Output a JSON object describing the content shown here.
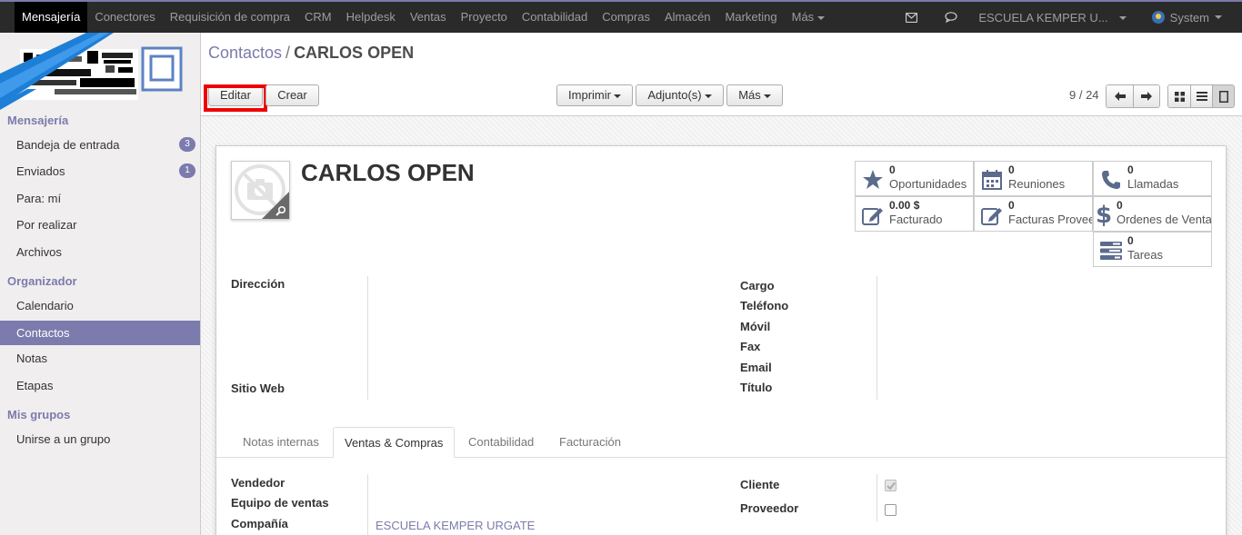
{
  "topbar": {
    "menus": [
      "Mensajería",
      "Conectores",
      "Requisición de compra",
      "CRM",
      "Helpdesk",
      "Ventas",
      "Proyecto",
      "Contabilidad",
      "Compras",
      "Almacén",
      "Marketing",
      "Más"
    ],
    "company": "ESCUELA KEMPER U...",
    "user": "System"
  },
  "sidebar": {
    "section_messaging": "Mensajería",
    "messaging_items": [
      {
        "label": "Bandeja de entrada",
        "badge": "3"
      },
      {
        "label": "Enviados",
        "badge": "1"
      },
      {
        "label": "Para: mí"
      },
      {
        "label": "Por realizar"
      },
      {
        "label": "Archivos"
      }
    ],
    "section_organizer": "Organizador",
    "organizer_items": [
      "Calendario",
      "Contactos",
      "Notas",
      "Etapas"
    ],
    "section_groups": "Mis grupos",
    "group_items": [
      "Unirse a un grupo"
    ]
  },
  "breadcrumb": {
    "parent": "Contactos",
    "separator": "/",
    "current": "CARLOS OPEN"
  },
  "buttons": {
    "edit": "Editar",
    "create": "Crear",
    "print": "Imprimir",
    "attachments": "Adjunto(s)",
    "more": "Más"
  },
  "pager": "9 / 24",
  "partner": {
    "name": "CARLOS OPEN"
  },
  "smart_buttons": [
    {
      "value": "0",
      "label": "Oportunidades",
      "icon": "star-icon"
    },
    {
      "value": "0",
      "label": "Reuniones",
      "icon": "calendar-icon"
    },
    {
      "value": "0",
      "label": "Llamadas",
      "icon": "phone-icon"
    },
    {
      "value": "0.00 $",
      "label": "Facturado",
      "icon": "edit-icon"
    },
    {
      "value": "0",
      "label": "Facturas Proveedor",
      "icon": "edit-icon"
    },
    {
      "value": "0",
      "label": "Ordenes de Venta",
      "icon": "dollar-icon"
    },
    {
      "value": "0",
      "label": "Tareas",
      "icon": "tasks-icon"
    }
  ],
  "fields_left": {
    "address": "Dirección",
    "website": "Sitio Web"
  },
  "fields_right": [
    "Cargo",
    "Teléfono",
    "Móvil",
    "Fax",
    "Email",
    "Título"
  ],
  "tabs": [
    "Notas internas",
    "Ventas & Compras",
    "Contabilidad",
    "Facturación"
  ],
  "sales": {
    "salesperson": "Vendedor",
    "sales_team": "Equipo de ventas",
    "company": "Compañía",
    "company_value": "ESCUELA KEMPER URGATE",
    "customer": "Cliente",
    "customer_checked": true,
    "supplier": "Proveedor",
    "supplier_checked": false
  },
  "colors": {
    "accent": "#7c7bad",
    "navbar": "#2a2a2a",
    "highlight": "#e00000"
  }
}
